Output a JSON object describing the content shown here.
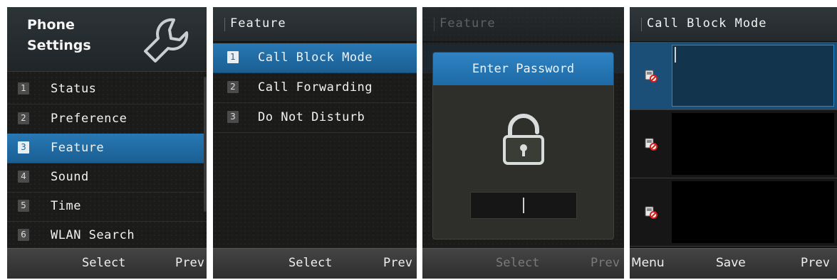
{
  "screen1": {
    "title_line1": "Phone",
    "title_line2": "Settings",
    "header_icon": "wrench-icon",
    "items": [
      {
        "num": "1",
        "label": "Status"
      },
      {
        "num": "2",
        "label": "Preference"
      },
      {
        "num": "3",
        "label": "Feature",
        "selected": true
      },
      {
        "num": "4",
        "label": "Sound"
      },
      {
        "num": "5",
        "label": "Time"
      },
      {
        "num": "6",
        "label": "WLAN Search"
      }
    ],
    "softkeys": {
      "center": "Select",
      "right": "Prev"
    }
  },
  "screen2": {
    "title": "Feature",
    "items": [
      {
        "num": "1",
        "label": "Call Block Mode",
        "selected": true
      },
      {
        "num": "2",
        "label": "Call Forwarding"
      },
      {
        "num": "3",
        "label": "Do Not Disturb"
      }
    ],
    "softkeys": {
      "center": "Select",
      "right": "Prev"
    }
  },
  "screen3": {
    "title": "Feature",
    "dialog_title": "Enter Password",
    "dialog_icon": "padlock-icon",
    "softkeys": {
      "center": "Select",
      "right": "Prev"
    }
  },
  "screen4": {
    "title": "Call Block Mode",
    "row_icon": "call-block-icon",
    "softkeys": {
      "left": "Menu",
      "center": "Save",
      "right": "Prev"
    }
  },
  "colors": {
    "selection_blue": "#1f6aa3",
    "dialog_title_blue": "#2a7cbf",
    "background": "#171717"
  }
}
